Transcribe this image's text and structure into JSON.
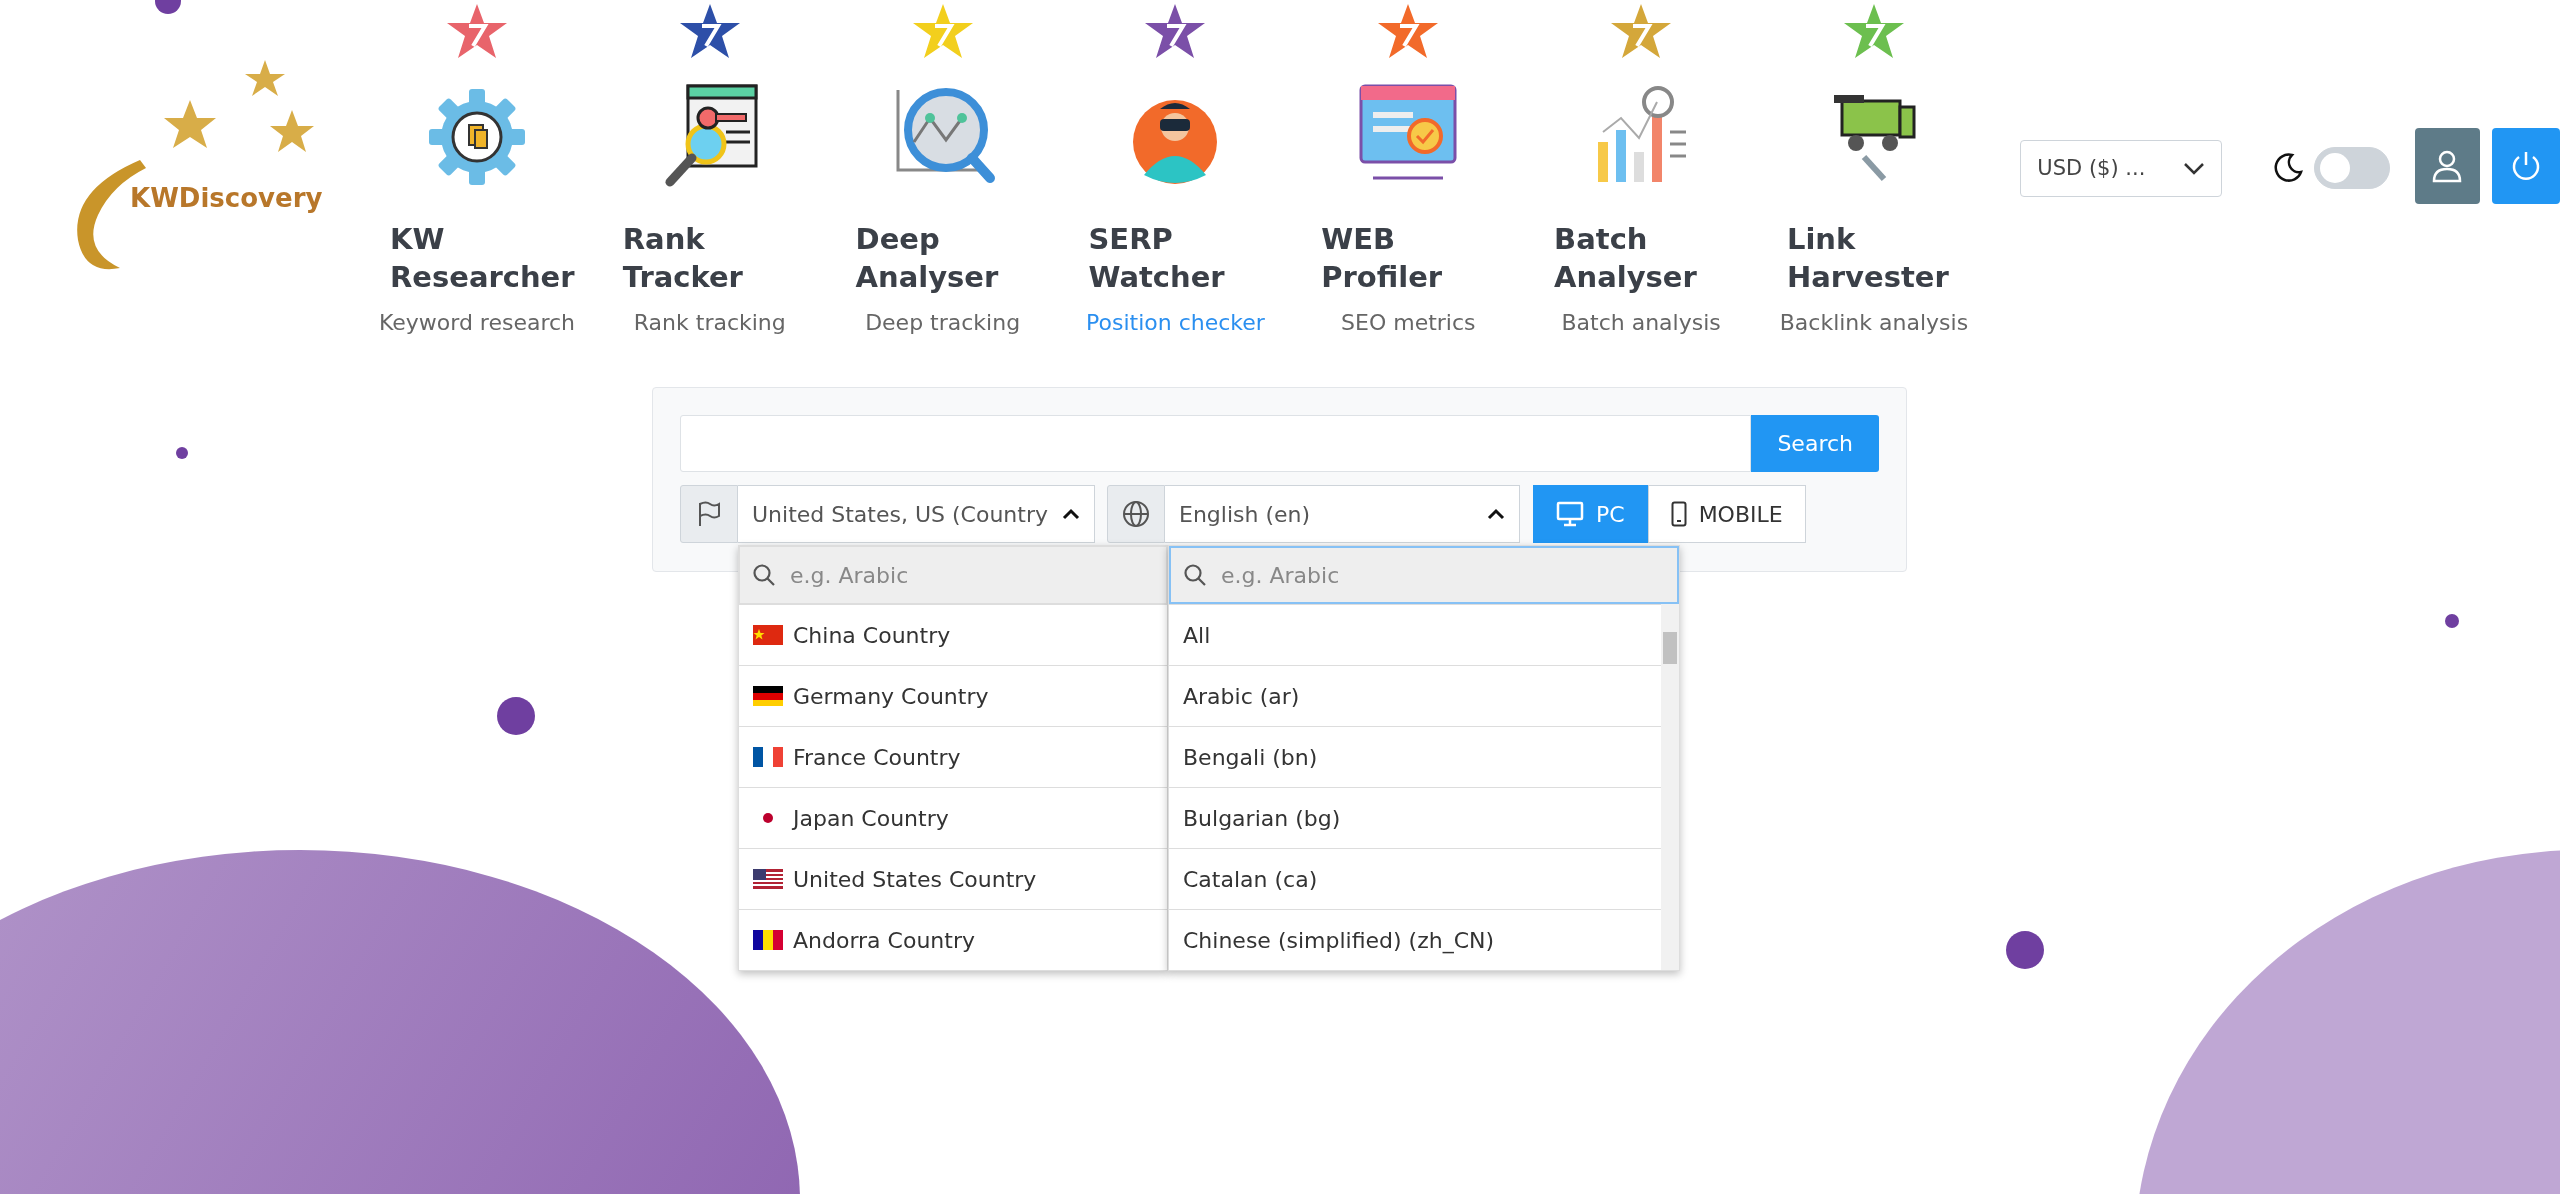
{
  "logo": {
    "text": "KWDiscovery"
  },
  "tools": [
    {
      "title": "KW Researcher",
      "subtitle": "Keyword research",
      "color": "#e8646b",
      "selected": false
    },
    {
      "title": "Rank Tracker",
      "subtitle": "Rank tracking",
      "color": "#2d4fa8",
      "selected": false
    },
    {
      "title": "Deep Analyser",
      "subtitle": "Deep tracking",
      "color": "#f2cf1d",
      "selected": false
    },
    {
      "title": "SERP Watcher",
      "subtitle": "Position checker",
      "color": "#7b4fa8",
      "selected": true
    },
    {
      "title": "WEB Profiler",
      "subtitle": "SEO metrics",
      "color": "#f26a2a",
      "selected": false
    },
    {
      "title": "Batch Analyser",
      "subtitle": "Batch analysis",
      "color": "#d4a73a",
      "selected": false
    },
    {
      "title": "Link Harvester",
      "subtitle": "Backlink analysis",
      "color": "#6cbf4f",
      "selected": false
    }
  ],
  "currency": {
    "value": "USD ($) ..."
  },
  "dark_mode": {
    "on": false
  },
  "search": {
    "button": "Search"
  },
  "country_select": {
    "value": "United States, US (Country",
    "expanded": true,
    "search_placeholder": "e.g. Arabic",
    "options": [
      {
        "label": "China Country",
        "kind": "cn"
      },
      {
        "label": "Germany Country",
        "kind": "de"
      },
      {
        "label": "France Country",
        "kind": "fr"
      },
      {
        "label": "Japan Country",
        "kind": "jp"
      },
      {
        "label": "United States Country",
        "kind": "us"
      },
      {
        "label": "Andorra Country",
        "kind": "ad"
      }
    ]
  },
  "language_select": {
    "value": "English (en)",
    "expanded": true,
    "search_placeholder": "e.g. Arabic",
    "options": [
      {
        "label": "All"
      },
      {
        "label": "Arabic (ar)"
      },
      {
        "label": "Bengali (bn)"
      },
      {
        "label": "Bulgarian (bg)"
      },
      {
        "label": "Catalan (ca)"
      },
      {
        "label": "Chinese (simplified) (zh_CN)"
      }
    ]
  },
  "device": [
    {
      "label": "PC",
      "kind": "desktop",
      "selected": true
    },
    {
      "label": "MOBILE",
      "kind": "mobile",
      "selected": false
    }
  ]
}
